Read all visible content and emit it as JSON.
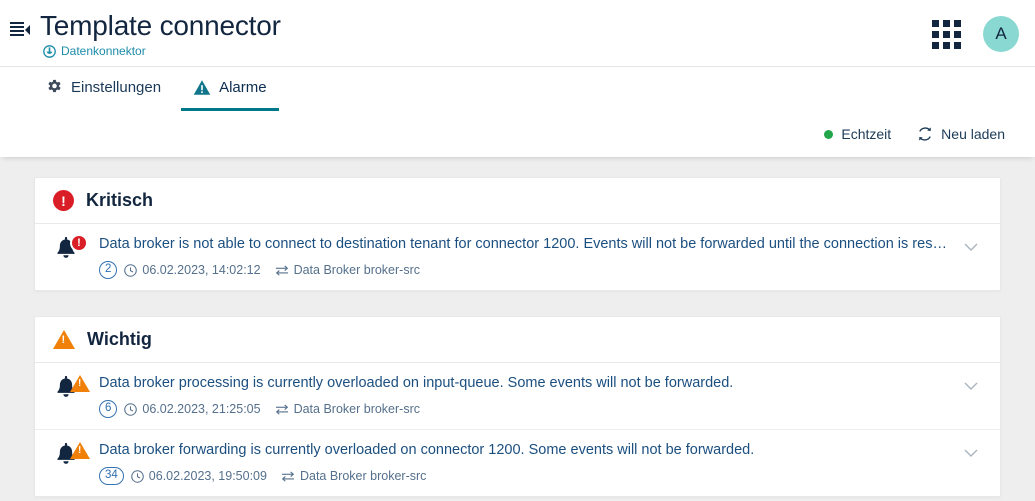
{
  "header": {
    "collapse_icon": "collapse-sidebar-icon",
    "title": "Template connector",
    "subtitle": "Datenkonnektor",
    "subtitle_icon": "connector-icon",
    "apps_icon": "app-grid-icon",
    "avatar_initial": "A"
  },
  "tabs": [
    {
      "label": "Einstellungen",
      "icon": "gear-icon",
      "active": false
    },
    {
      "label": "Alarme",
      "icon": "warning-triangle-icon",
      "active": true
    }
  ],
  "toolbar": {
    "realtime_label": "Echtzeit",
    "realtime_active": true,
    "reload_label": "Neu laden",
    "reload_icon": "refresh-icon"
  },
  "colors": {
    "accent_teal": "#00788a",
    "critical_red": "#da1e28",
    "warning_orange": "#f08008",
    "realtime_green": "#22a64a",
    "avatar_bg": "#8ad8d2",
    "title_navy": "#12263f",
    "link_blue": "#1b4f80"
  },
  "sections": [
    {
      "severity": "critical",
      "title": "Kritisch",
      "icon": "critical-circle-icon",
      "alarms": [
        {
          "message": "Data broker is not able to connect to destination tenant for connector 1200. Events will not be forwarded until the connection is restored.",
          "count": "2",
          "timestamp": "06.02.2023, 14:02:12",
          "source": "Data Broker broker-src",
          "bell_icon": "bell-icon",
          "clock_icon": "clock-icon",
          "source_icon": "transfer-icon",
          "expand_icon": "chevron-down-icon"
        }
      ]
    },
    {
      "severity": "warning",
      "title": "Wichtig",
      "icon": "warning-triangle-icon",
      "alarms": [
        {
          "message": "Data broker processing is currently overloaded on input-queue. Some events will not be forwarded.",
          "count": "6",
          "timestamp": "06.02.2023, 21:25:05",
          "source": "Data Broker broker-src",
          "bell_icon": "bell-icon",
          "clock_icon": "clock-icon",
          "source_icon": "transfer-icon",
          "expand_icon": "chevron-down-icon"
        },
        {
          "message": "Data broker forwarding is currently overloaded on connector 1200. Some events will not be forwarded.",
          "count": "34",
          "timestamp": "06.02.2023, 19:50:09",
          "source": "Data Broker broker-src",
          "bell_icon": "bell-icon",
          "clock_icon": "clock-icon",
          "source_icon": "transfer-icon",
          "expand_icon": "chevron-down-icon"
        }
      ]
    }
  ]
}
